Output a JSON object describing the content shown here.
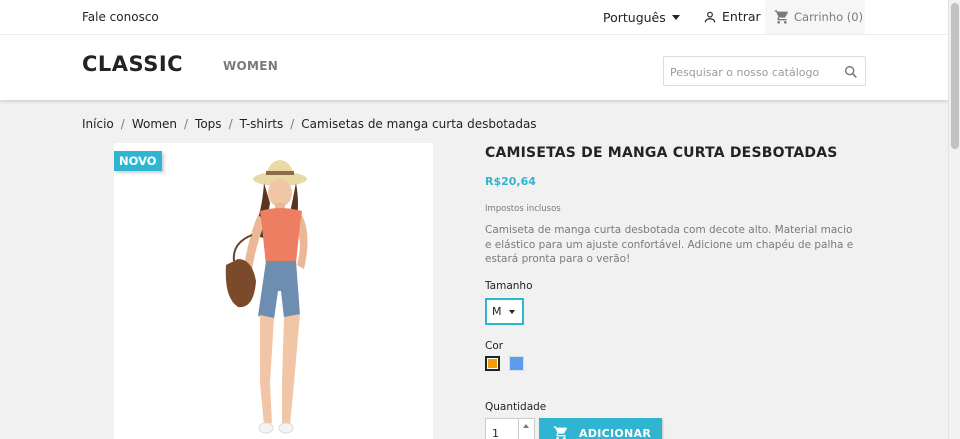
{
  "topbar": {
    "contact": "Fale conosco",
    "language": "Português",
    "sign_in": "Entrar",
    "cart": "Carrinho (0)"
  },
  "header": {
    "logo": "CLASSIC",
    "nav": [
      "WOMEN"
    ],
    "search_placeholder": "Pesquisar o nosso catálogo"
  },
  "breadcrumb": [
    "Início",
    "Women",
    "Tops",
    "T-shirts",
    "Camisetas de manga curta desbotadas"
  ],
  "product": {
    "badge": "NOVO",
    "title": "CAMISETAS DE MANGA CURTA DESBOTADAS",
    "price": "R$20,64",
    "taxes": "Impostos inclusos",
    "description": "Camiseta de manga curta desbotada com decote alto. Material macio e elástico para um ajuste confortável. Adicione um chapéu de palha e estará pronta para o verão!",
    "size_label": "Tamanho",
    "size_value": "M",
    "color_label": "Cor",
    "colors": [
      "#f39d00",
      "#5d9cec"
    ],
    "quantity_label": "Quantidade",
    "quantity_value": "1",
    "add_to_cart": "ADICIONAR"
  },
  "colors": {
    "accent": "#2fb5d2",
    "text": "#232323",
    "muted": "#7a7a7a"
  }
}
